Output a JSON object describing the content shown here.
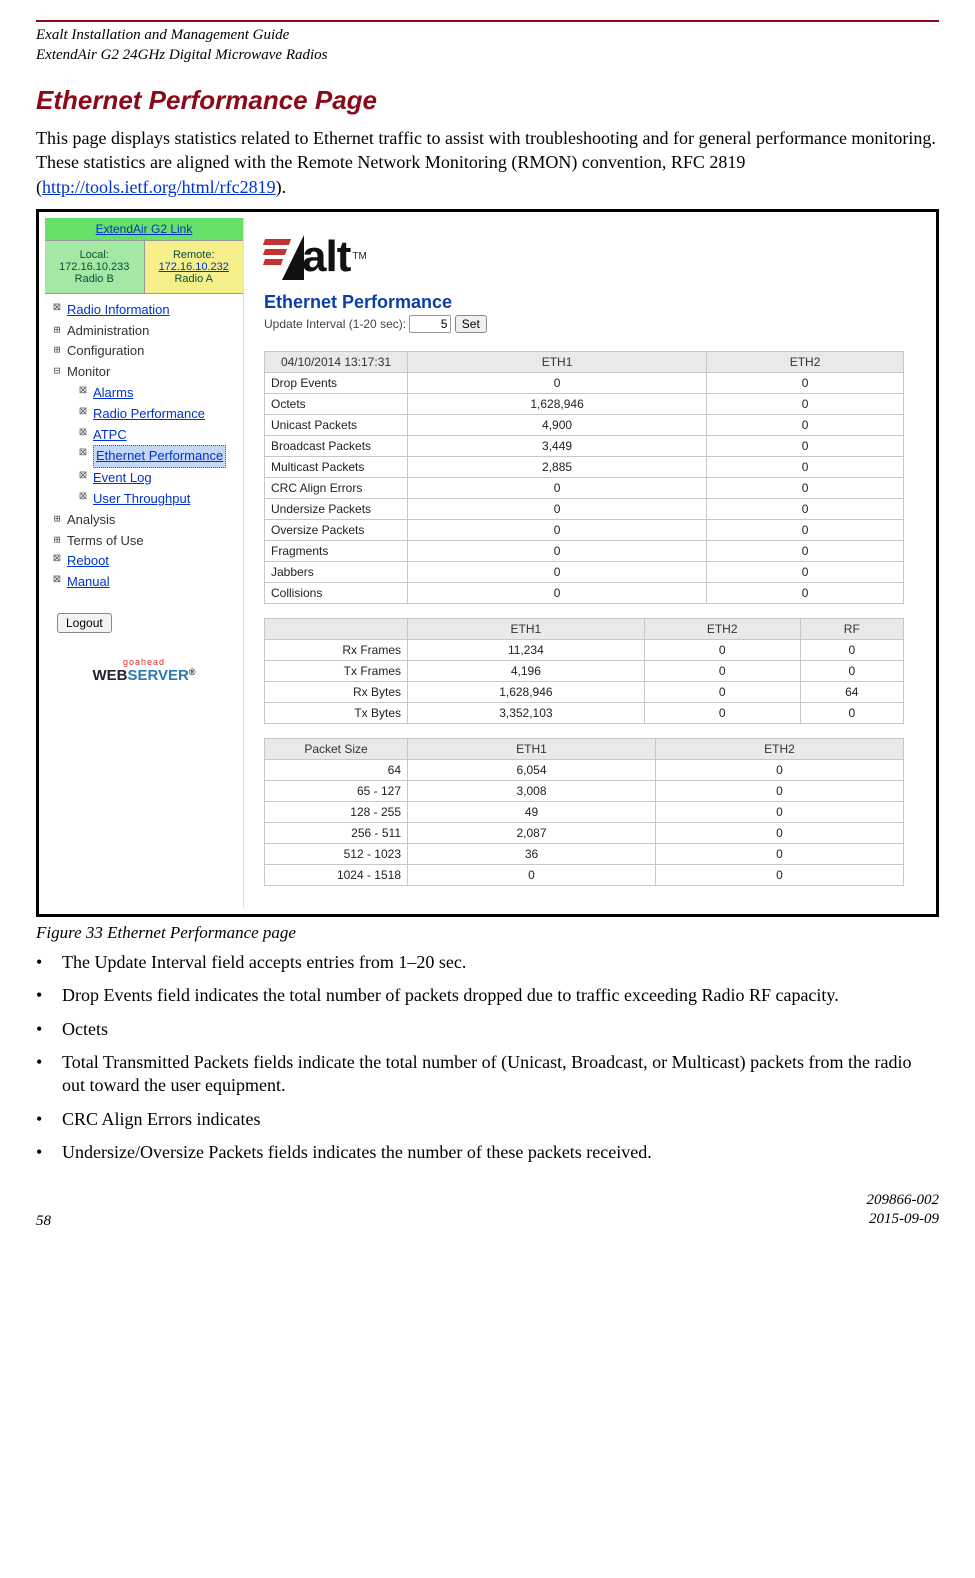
{
  "doc": {
    "header_line1": "Exalt Installation and Management Guide",
    "header_line2": "ExtendAir G2 24GHz Digital Microwave Radios",
    "section_title": "Ethernet Performance Page",
    "paragraph_pre": "This page displays statistics related to Ethernet traffic to assist with troubleshooting and for general performance monitoring. These statistics are aligned with the Remote Network Monitoring (RMON) convention, RFC 2819 (",
    "paragraph_link_text": "http://tools.ietf.org/html/rfc2819",
    "paragraph_post": ").",
    "figure_caption": "Figure 33   Ethernet Performance page",
    "bullets": [
      "The Update Interval field accepts entries from 1–20 sec.",
      "Drop Events field indicates the total number of packets dropped due to traffic exceeding Radio RF capacity.",
      "Octets",
      "Total Transmitted Packets fields indicate the total number of (Unicast, Broadcast, or Multicast) packets from the radio out toward the user equipment.",
      "CRC Align Errors indicates",
      "Undersize/Oversize Packets fields indicates the number of these packets received."
    ],
    "footer_page": "58",
    "footer_docnum": "209866-002",
    "footer_date": "2015-09-09"
  },
  "app": {
    "link_title": "ExtendAir G2 Link",
    "local": {
      "label": "Local:",
      "ip": "172.16.10.233",
      "radio": "Radio B"
    },
    "remote": {
      "label": "Remote:",
      "ip": "172.16.10.232",
      "radio": "Radio A"
    },
    "nav": {
      "radio_info": "Radio Information",
      "administration": "Administration",
      "configuration": "Configuration",
      "monitor": "Monitor",
      "alarms": "Alarms",
      "radio_perf": "Radio Performance",
      "atpc": "ATPC",
      "eth_perf": "Ethernet Performance",
      "event_log": "Event Log",
      "user_throughput": "User Throughput",
      "analysis": "Analysis",
      "terms": "Terms of Use",
      "reboot": "Reboot",
      "manual": "Manual"
    },
    "logout": "Logout",
    "webserver": {
      "top": "goahead",
      "left": "WEB",
      "right": "SERVER"
    },
    "brand": {
      "name": "alt",
      "tm": "TM"
    },
    "panel_title": "Ethernet Performance",
    "update_label": "Update Interval (1-20 sec):",
    "update_value": "5",
    "set_label": "Set",
    "table1": {
      "timestamp": "04/10/2014 13:17:31",
      "col_eth1": "ETH1",
      "col_eth2": "ETH2",
      "rows": [
        {
          "label": "Drop Events",
          "eth1": "0",
          "eth2": "0"
        },
        {
          "label": "Octets",
          "eth1": "1,628,946",
          "eth2": "0"
        },
        {
          "label": "Unicast Packets",
          "eth1": "4,900",
          "eth2": "0"
        },
        {
          "label": "Broadcast Packets",
          "eth1": "3,449",
          "eth2": "0"
        },
        {
          "label": "Multicast Packets",
          "eth1": "2,885",
          "eth2": "0"
        },
        {
          "label": "CRC Align Errors",
          "eth1": "0",
          "eth2": "0"
        },
        {
          "label": "Undersize Packets",
          "eth1": "0",
          "eth2": "0"
        },
        {
          "label": "Oversize Packets",
          "eth1": "0",
          "eth2": "0"
        },
        {
          "label": "Fragments",
          "eth1": "0",
          "eth2": "0"
        },
        {
          "label": "Jabbers",
          "eth1": "0",
          "eth2": "0"
        },
        {
          "label": "Collisions",
          "eth1": "0",
          "eth2": "0"
        }
      ]
    },
    "table2": {
      "col_eth1": "ETH1",
      "col_eth2": "ETH2",
      "col_rf": "RF",
      "rows": [
        {
          "label": "Rx Frames",
          "eth1": "11,234",
          "eth2": "0",
          "rf": "0"
        },
        {
          "label": "Tx Frames",
          "eth1": "4,196",
          "eth2": "0",
          "rf": "0"
        },
        {
          "label": "Rx Bytes",
          "eth1": "1,628,946",
          "eth2": "0",
          "rf": "64"
        },
        {
          "label": "Tx Bytes",
          "eth1": "3,352,103",
          "eth2": "0",
          "rf": "0"
        }
      ]
    },
    "table3": {
      "col_size": "Packet Size",
      "col_eth1": "ETH1",
      "col_eth2": "ETH2",
      "rows": [
        {
          "label": "64",
          "eth1": "6,054",
          "eth2": "0"
        },
        {
          "label": "65 - 127",
          "eth1": "3,008",
          "eth2": "0"
        },
        {
          "label": "128 - 255",
          "eth1": "49",
          "eth2": "0"
        },
        {
          "label": "256 - 511",
          "eth1": "2,087",
          "eth2": "0"
        },
        {
          "label": "512 - 1023",
          "eth1": "36",
          "eth2": "0"
        },
        {
          "label": "1024 - 1518",
          "eth1": "0",
          "eth2": "0"
        }
      ]
    }
  }
}
